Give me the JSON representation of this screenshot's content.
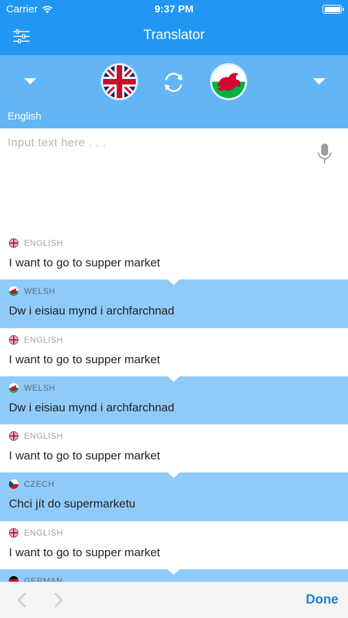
{
  "status": {
    "carrier": "Carrier",
    "time": "9:37 PM"
  },
  "nav": {
    "title": "Translator",
    "menu_icon": "sliders-icon"
  },
  "lang": {
    "source_label": "English",
    "source_flag": "uk-flag-icon",
    "target_flag": "wales-flag-icon",
    "swap_icon": "swap-icon"
  },
  "input": {
    "placeholder": "Input text here . . .",
    "value": "",
    "mic_icon": "microphone-icon"
  },
  "history": [
    {
      "lang": "ENGLISH",
      "flag": "uk",
      "text": "I want to go to supper market",
      "style": "white"
    },
    {
      "lang": "WELSH",
      "flag": "wales",
      "text": "Dw i eisiau mynd i archfarchnad",
      "style": "blue"
    },
    {
      "lang": "ENGLISH",
      "flag": "uk",
      "text": "I want to go to supper market",
      "style": "white"
    },
    {
      "lang": "WELSH",
      "flag": "wales",
      "text": "Dw i eisiau mynd i archfarchnad",
      "style": "blue"
    },
    {
      "lang": "ENGLISH",
      "flag": "uk",
      "text": "I want to go to supper market",
      "style": "white"
    },
    {
      "lang": "CZECH",
      "flag": "czech",
      "text": "Chci jít do supermarketu",
      "style": "blue"
    },
    {
      "lang": "ENGLISH",
      "flag": "uk",
      "text": "I want to go to supper market",
      "style": "white"
    },
    {
      "lang": "GERMAN",
      "flag": "germany",
      "text": "",
      "style": "blue"
    }
  ],
  "toolbar": {
    "done_label": "Done"
  },
  "colors": {
    "nav_bg": "#2196f3",
    "lang_band_bg": "#64b5f6",
    "translation_bg": "#90caf9",
    "done": "#1a82e2"
  }
}
